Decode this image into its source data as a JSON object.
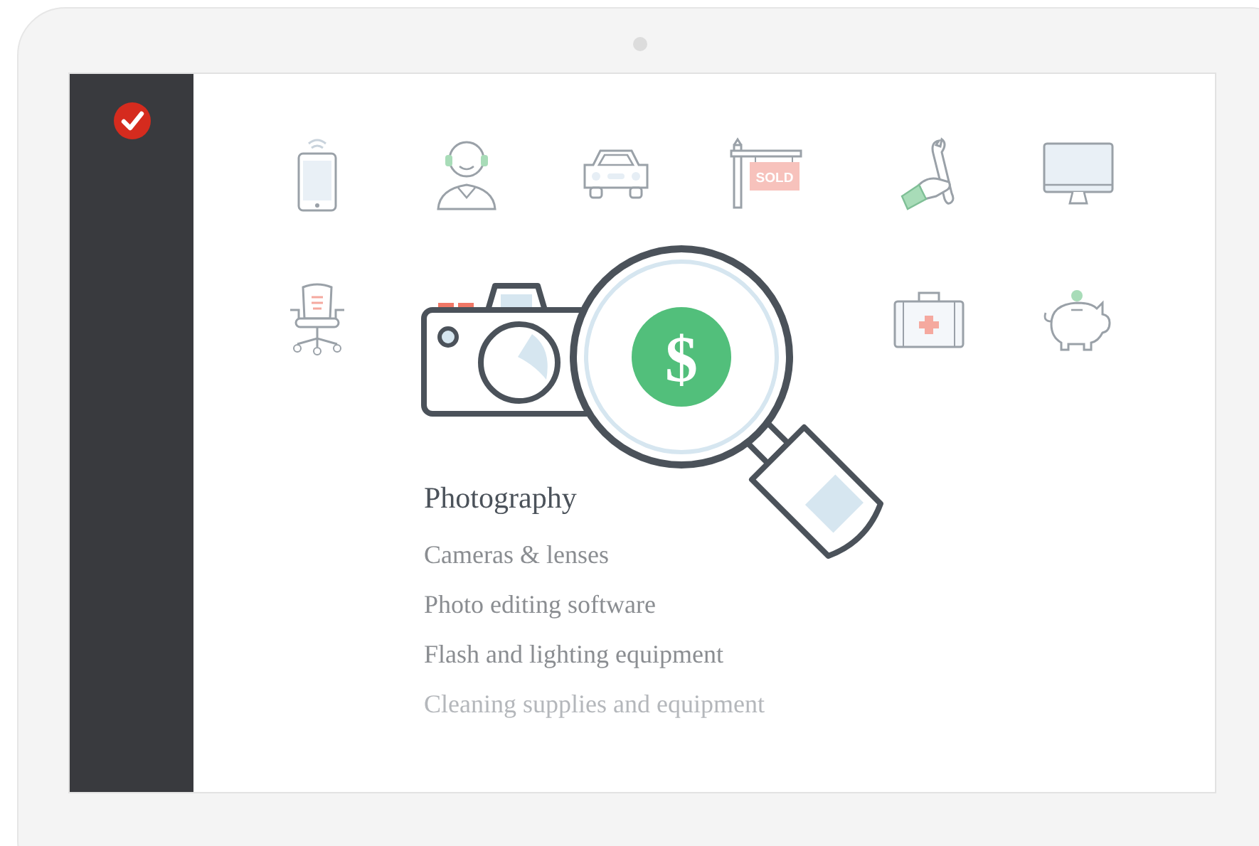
{
  "icon_grid": {
    "sign_text": "SOLD"
  },
  "hero": {
    "symbol": "$"
  },
  "category": {
    "title": "Photography",
    "items": [
      {
        "label": "Cameras & lenses",
        "faded": false
      },
      {
        "label": "Photo editing software",
        "faded": false
      },
      {
        "label": "Flash and lighting equipment",
        "faded": false
      },
      {
        "label": "Cleaning supplies and equipment",
        "faded": true
      }
    ]
  }
}
